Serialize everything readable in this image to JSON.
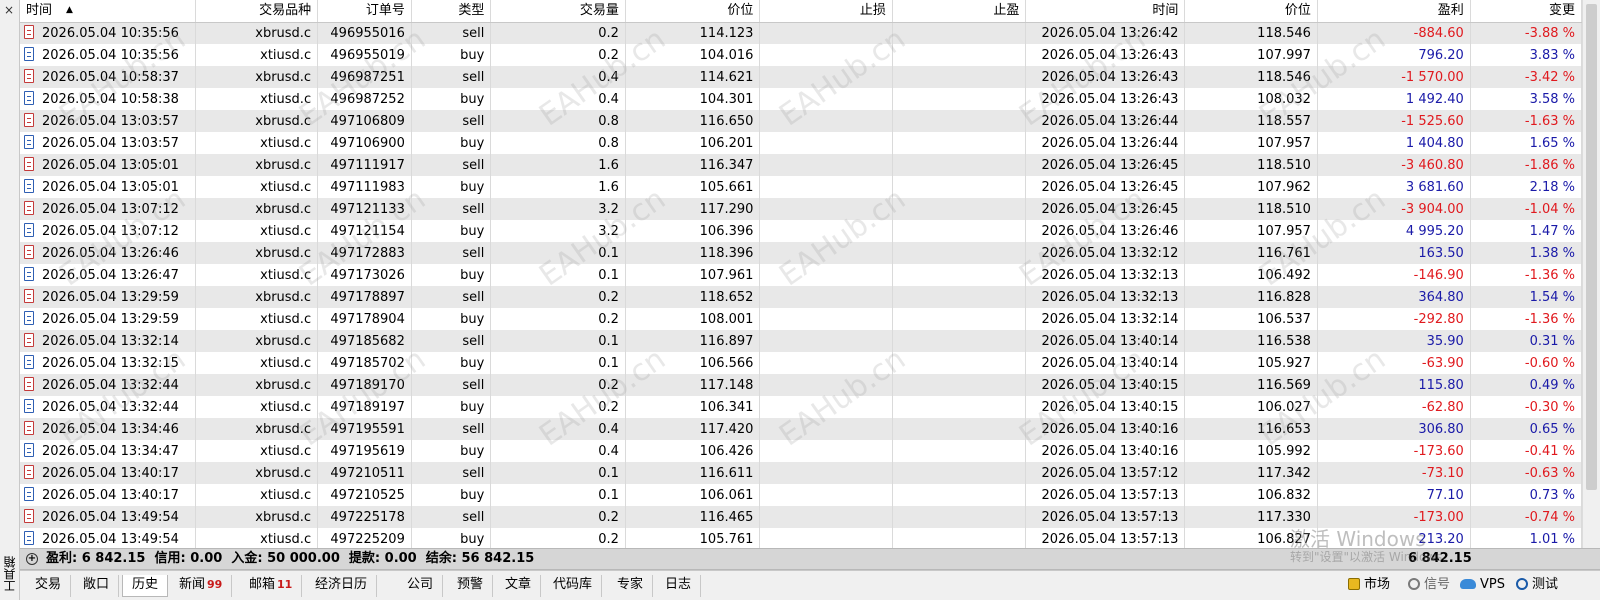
{
  "sidebar": {
    "label": "工具箱",
    "close_glyph": "×"
  },
  "table": {
    "columns": [
      "时间",
      "交易品种",
      "订单号",
      "类型",
      "交易量",
      "价位",
      "止损",
      "止盈",
      "时间",
      "价位",
      "盈利",
      "变更"
    ],
    "sort_indicator": "▲",
    "rows": [
      [
        "2026.05.04 10:35:56",
        "xbrusd.c",
        "496955016",
        "sell",
        "0.2",
        "114.123",
        "",
        "",
        "2026.05.04 13:26:42",
        "118.546",
        "-884.60",
        "-3.88 %"
      ],
      [
        "2026.05.04 10:35:56",
        "xtiusd.c",
        "496955019",
        "buy",
        "0.2",
        "104.016",
        "",
        "",
        "2026.05.04 13:26:43",
        "107.997",
        "796.20",
        "3.83 %"
      ],
      [
        "2026.05.04 10:58:37",
        "xbrusd.c",
        "496987251",
        "sell",
        "0.4",
        "114.621",
        "",
        "",
        "2026.05.04 13:26:43",
        "118.546",
        "-1 570.00",
        "-3.42 %"
      ],
      [
        "2026.05.04 10:58:38",
        "xtiusd.c",
        "496987252",
        "buy",
        "0.4",
        "104.301",
        "",
        "",
        "2026.05.04 13:26:43",
        "108.032",
        "1 492.40",
        "3.58 %"
      ],
      [
        "2026.05.04 13:03:57",
        "xbrusd.c",
        "497106809",
        "sell",
        "0.8",
        "116.650",
        "",
        "",
        "2026.05.04 13:26:44",
        "118.557",
        "-1 525.60",
        "-1.63 %"
      ],
      [
        "2026.05.04 13:03:57",
        "xtiusd.c",
        "497106900",
        "buy",
        "0.8",
        "106.201",
        "",
        "",
        "2026.05.04 13:26:44",
        "107.957",
        "1 404.80",
        "1.65 %"
      ],
      [
        "2026.05.04 13:05:01",
        "xbrusd.c",
        "497111917",
        "sell",
        "1.6",
        "116.347",
        "",
        "",
        "2026.05.04 13:26:45",
        "118.510",
        "-3 460.80",
        "-1.86 %"
      ],
      [
        "2026.05.04 13:05:01",
        "xtiusd.c",
        "497111983",
        "buy",
        "1.6",
        "105.661",
        "",
        "",
        "2026.05.04 13:26:45",
        "107.962",
        "3 681.60",
        "2.18 %"
      ],
      [
        "2026.05.04 13:07:12",
        "xbrusd.c",
        "497121133",
        "sell",
        "3.2",
        "117.290",
        "",
        "",
        "2026.05.04 13:26:45",
        "118.510",
        "-3 904.00",
        "-1.04 %"
      ],
      [
        "2026.05.04 13:07:12",
        "xtiusd.c",
        "497121154",
        "buy",
        "3.2",
        "106.396",
        "",
        "",
        "2026.05.04 13:26:46",
        "107.957",
        "4 995.20",
        "1.47 %"
      ],
      [
        "2026.05.04 13:26:46",
        "xbrusd.c",
        "497172883",
        "sell",
        "0.1",
        "118.396",
        "",
        "",
        "2026.05.04 13:32:12",
        "116.761",
        "163.50",
        "1.38 %"
      ],
      [
        "2026.05.04 13:26:47",
        "xtiusd.c",
        "497173026",
        "buy",
        "0.1",
        "107.961",
        "",
        "",
        "2026.05.04 13:32:13",
        "106.492",
        "-146.90",
        "-1.36 %"
      ],
      [
        "2026.05.04 13:29:59",
        "xbrusd.c",
        "497178897",
        "sell",
        "0.2",
        "118.652",
        "",
        "",
        "2026.05.04 13:32:13",
        "116.828",
        "364.80",
        "1.54 %"
      ],
      [
        "2026.05.04 13:29:59",
        "xtiusd.c",
        "497178904",
        "buy",
        "0.2",
        "108.001",
        "",
        "",
        "2026.05.04 13:32:14",
        "106.537",
        "-292.80",
        "-1.36 %"
      ],
      [
        "2026.05.04 13:32:14",
        "xbrusd.c",
        "497185682",
        "sell",
        "0.1",
        "116.897",
        "",
        "",
        "2026.05.04 13:40:14",
        "116.538",
        "35.90",
        "0.31 %"
      ],
      [
        "2026.05.04 13:32:15",
        "xtiusd.c",
        "497185702",
        "buy",
        "0.1",
        "106.566",
        "",
        "",
        "2026.05.04 13:40:14",
        "105.927",
        "-63.90",
        "-0.60 %"
      ],
      [
        "2026.05.04 13:32:44",
        "xbrusd.c",
        "497189170",
        "sell",
        "0.2",
        "117.148",
        "",
        "",
        "2026.05.04 13:40:15",
        "116.569",
        "115.80",
        "0.49 %"
      ],
      [
        "2026.05.04 13:32:44",
        "xtiusd.c",
        "497189197",
        "buy",
        "0.2",
        "106.341",
        "",
        "",
        "2026.05.04 13:40:15",
        "106.027",
        "-62.80",
        "-0.30 %"
      ],
      [
        "2026.05.04 13:34:46",
        "xbrusd.c",
        "497195591",
        "sell",
        "0.4",
        "117.420",
        "",
        "",
        "2026.05.04 13:40:16",
        "116.653",
        "306.80",
        "0.65 %"
      ],
      [
        "2026.05.04 13:34:47",
        "xtiusd.c",
        "497195619",
        "buy",
        "0.4",
        "106.426",
        "",
        "",
        "2026.05.04 13:40:16",
        "105.992",
        "-173.60",
        "-0.41 %"
      ],
      [
        "2026.05.04 13:40:17",
        "xbrusd.c",
        "497210511",
        "sell",
        "0.1",
        "116.611",
        "",
        "",
        "2026.05.04 13:57:12",
        "117.342",
        "-73.10",
        "-0.63 %"
      ],
      [
        "2026.05.04 13:40:17",
        "xtiusd.c",
        "497210525",
        "buy",
        "0.1",
        "106.061",
        "",
        "",
        "2026.05.04 13:57:13",
        "106.832",
        "77.10",
        "0.73 %"
      ],
      [
        "2026.05.04 13:49:54",
        "xbrusd.c",
        "497225178",
        "sell",
        "0.2",
        "116.465",
        "",
        "",
        "2026.05.04 13:57:13",
        "117.330",
        "-173.00",
        "-0.74 %"
      ],
      [
        "2026.05.04 13:49:54",
        "xtiusd.c",
        "497225209",
        "buy",
        "0.2",
        "105.761",
        "",
        "",
        "2026.05.04 13:57:13",
        "106.827",
        "213.20",
        "1.01 %"
      ]
    ]
  },
  "summary": {
    "text": "盈利: 6 842.15  信用: 0.00  入金: 50 000.00  提款: 0.00  结余: 56 842.15",
    "total": "6 842.15"
  },
  "tabs": [
    {
      "label": "交易"
    },
    {
      "label": "敞口"
    },
    {
      "label": "历史",
      "active": true
    },
    {
      "label": "新闻",
      "badge": "99"
    },
    {
      "label": "邮箱",
      "badge": "11"
    },
    {
      "label": "经济日历"
    },
    {
      "label": "公司"
    },
    {
      "label": "预警"
    },
    {
      "label": "文章"
    },
    {
      "label": "代码库"
    },
    {
      "label": "专家"
    },
    {
      "label": "日志"
    }
  ],
  "status_right": {
    "market": "市场",
    "signals": "信号",
    "vps": "VPS",
    "tester": "测试"
  },
  "watermark": {
    "text": "EAHub.cn"
  },
  "windows_activation": {
    "title": "激活 Windows",
    "subtitle": "转到\"设置\"以激活 Windows。"
  },
  "colors": {
    "negative": "#e0191e",
    "positive": "#1a1aa8",
    "row_alt": "#e8e8e8",
    "summary_bg": "#d6d6d6"
  }
}
